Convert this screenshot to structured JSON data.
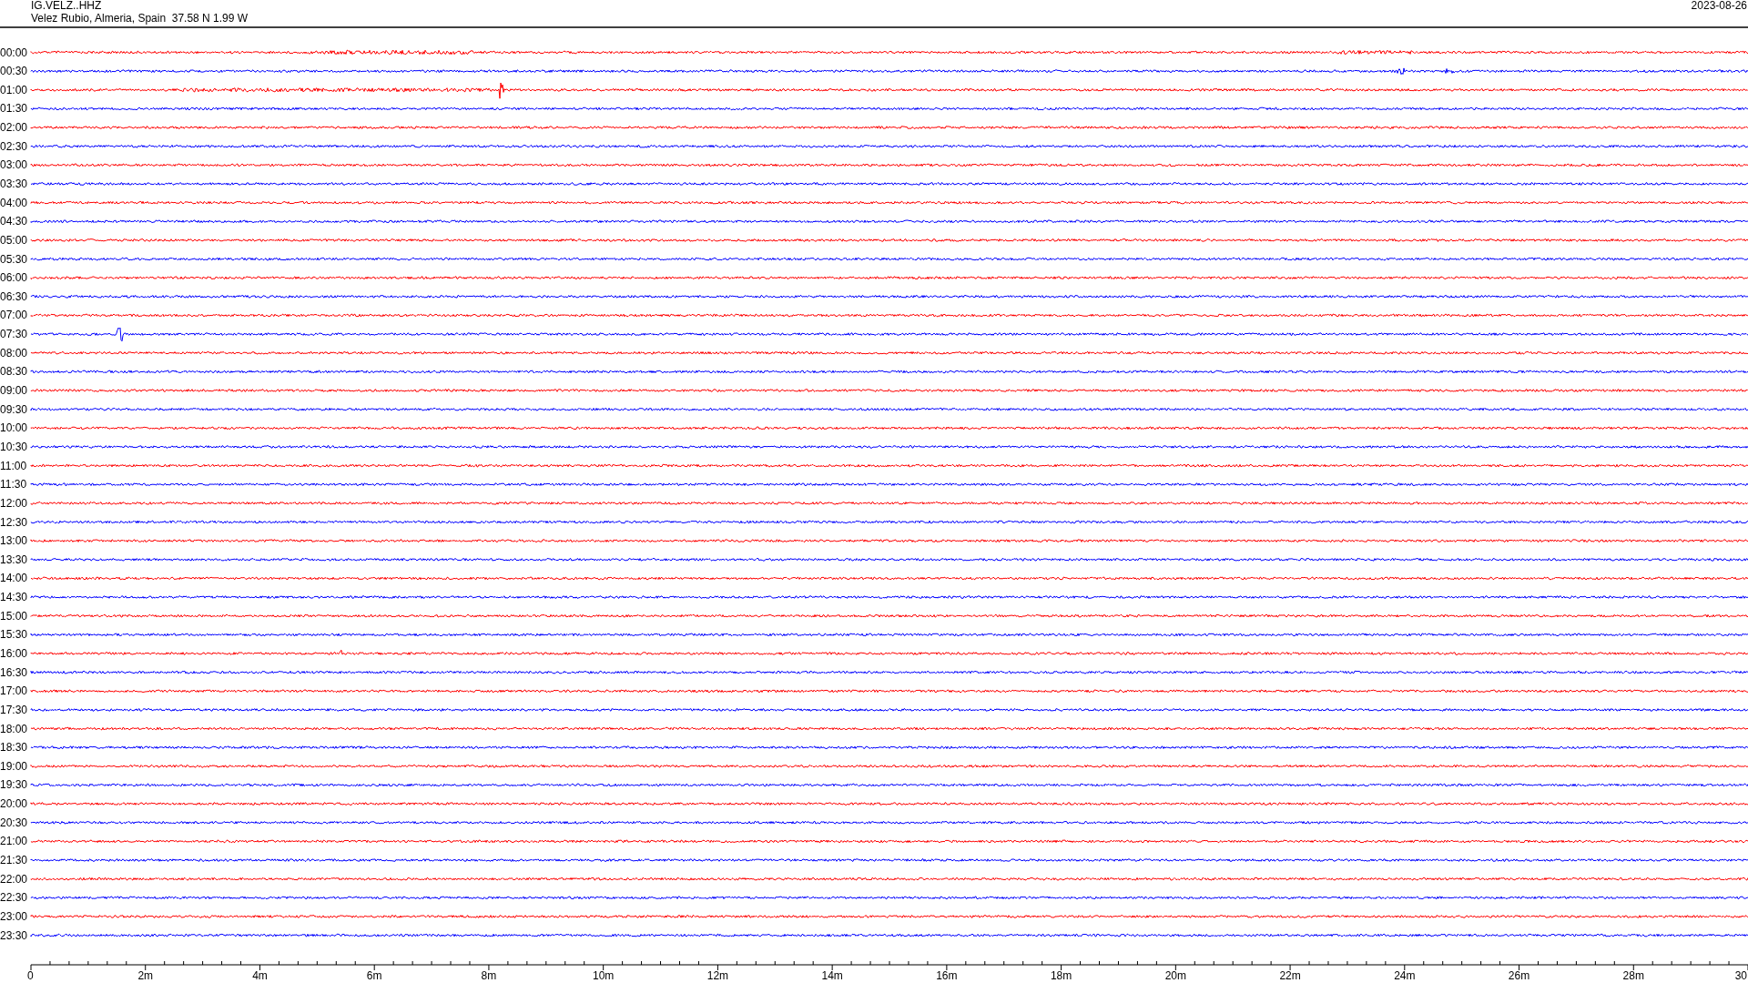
{
  "header": {
    "station": "IG.VELZ..HHZ",
    "location": "Velez Rubio, Almeria, Spain  37.58 N 1.99 W",
    "date": "2023-08-26"
  },
  "traces": [
    {
      "label": "00:00",
      "color": "#ff0000"
    },
    {
      "label": "00:30",
      "color": "#0000ff"
    },
    {
      "label": "01:00",
      "color": "#ff0000"
    },
    {
      "label": "01:30",
      "color": "#0000ff"
    },
    {
      "label": "02:00",
      "color": "#ff0000"
    },
    {
      "label": "02:30",
      "color": "#0000ff"
    },
    {
      "label": "03:00",
      "color": "#ff0000"
    },
    {
      "label": "03:30",
      "color": "#0000ff"
    },
    {
      "label": "04:00",
      "color": "#ff0000"
    },
    {
      "label": "04:30",
      "color": "#0000ff"
    },
    {
      "label": "05:00",
      "color": "#ff0000"
    },
    {
      "label": "05:30",
      "color": "#0000ff"
    },
    {
      "label": "06:00",
      "color": "#ff0000"
    },
    {
      "label": "06:30",
      "color": "#0000ff"
    },
    {
      "label": "07:00",
      "color": "#ff0000"
    },
    {
      "label": "07:30",
      "color": "#0000ff"
    },
    {
      "label": "08:00",
      "color": "#ff0000"
    },
    {
      "label": "08:30",
      "color": "#0000ff"
    },
    {
      "label": "09:00",
      "color": "#ff0000"
    },
    {
      "label": "09:30",
      "color": "#0000ff"
    },
    {
      "label": "10:00",
      "color": "#ff0000"
    },
    {
      "label": "10:30",
      "color": "#0000ff"
    },
    {
      "label": "11:00",
      "color": "#ff0000"
    },
    {
      "label": "11:30",
      "color": "#0000ff"
    },
    {
      "label": "12:00",
      "color": "#ff0000"
    },
    {
      "label": "12:30",
      "color": "#0000ff"
    },
    {
      "label": "13:00",
      "color": "#ff0000"
    },
    {
      "label": "13:30",
      "color": "#0000ff"
    },
    {
      "label": "14:00",
      "color": "#ff0000"
    },
    {
      "label": "14:30",
      "color": "#0000ff"
    },
    {
      "label": "15:00",
      "color": "#ff0000"
    },
    {
      "label": "15:30",
      "color": "#0000ff"
    },
    {
      "label": "16:00",
      "color": "#ff0000"
    },
    {
      "label": "16:30",
      "color": "#0000ff"
    },
    {
      "label": "17:00",
      "color": "#ff0000"
    },
    {
      "label": "17:30",
      "color": "#0000ff"
    },
    {
      "label": "18:00",
      "color": "#ff0000"
    },
    {
      "label": "18:30",
      "color": "#0000ff"
    },
    {
      "label": "19:00",
      "color": "#ff0000"
    },
    {
      "label": "19:30",
      "color": "#0000ff"
    },
    {
      "label": "20:00",
      "color": "#ff0000"
    },
    {
      "label": "20:30",
      "color": "#0000ff"
    },
    {
      "label": "21:00",
      "color": "#ff0000"
    },
    {
      "label": "21:30",
      "color": "#0000ff"
    },
    {
      "label": "22:00",
      "color": "#ff0000"
    },
    {
      "label": "22:30",
      "color": "#0000ff"
    },
    {
      "label": "23:00",
      "color": "#ff0000"
    },
    {
      "label": "23:30",
      "color": "#0000ff"
    }
  ],
  "time_axis": {
    "labels": [
      "0",
      "2m",
      "4m",
      "6m",
      "8m",
      "10m",
      "12m",
      "14m",
      "16m",
      "18m",
      "20m",
      "22m",
      "24m",
      "26m",
      "28m",
      "30"
    ]
  }
}
